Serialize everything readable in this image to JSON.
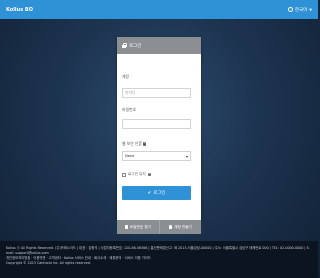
{
  "topbar": {
    "brand": "Kollus BO",
    "language": "한국어",
    "globe_icon": "globe-icon",
    "accent_color": "#2f92d6"
  },
  "login": {
    "header_title": "로그인",
    "header_icon": "lock-icon",
    "username_label": "계정",
    "username_placeholder": "아이디",
    "password_label": "비밀번호",
    "password_value": "",
    "otp_label": "웹 보안 인증",
    "otp_selected": "None",
    "remember_label": "로그인 유지",
    "submit_label": "로그인",
    "submit_icon": "check-icon"
  },
  "card_footer": {
    "find_password": "비밀번호 찾기",
    "find_password_icon": "key-icon",
    "signup": "계정 만들기",
    "signup_icon": "person-icon"
  },
  "footer": {
    "text_line1": "Kollus ⓒ All Rights Reserved. (주)카테노이드 | 대표 : 김형석 | 사업자등록번호: 120-86-56586 | 통신판매업신고: 제 2013-서울강남-00000 | 주소: 서울특별시 강남구 테헤란로 000 | TEL: 02-0000-0000 | E-mail: support@kollus.com",
    "text_line2": "개인정보처리방침 · 이용약관 · 고객센터 · Kollus 서비스 안내 · 회사소개 · 제휴문의 · 서비스 이용 가이드",
    "text_line3": "Copyright © 2013 Catenoid Inc. All rights reserved."
  }
}
